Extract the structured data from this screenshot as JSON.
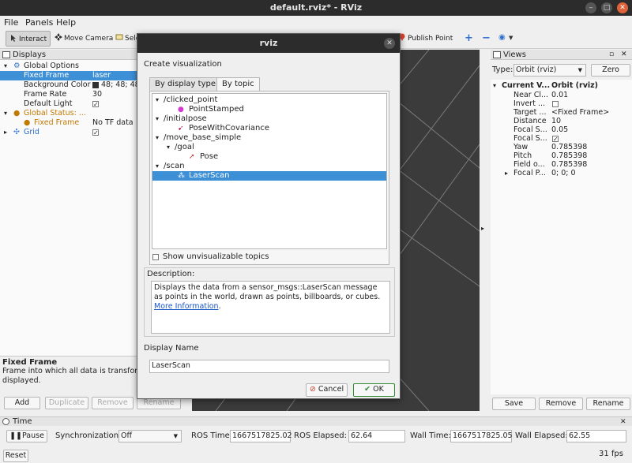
{
  "window": {
    "title": "default.rviz* - RViz"
  },
  "menu": [
    "File",
    "Panels",
    "Help"
  ],
  "toolbar": {
    "interact": "Interact",
    "move_camera": "Move Camera",
    "select": "Sele",
    "publish_point": "Publish Point"
  },
  "displays": {
    "header": "Displays",
    "rows": [
      {
        "indent": 1,
        "label": "Global Options",
        "value": ""
      },
      {
        "indent": 2,
        "label": "Fixed Frame",
        "value": "laser"
      },
      {
        "indent": 2,
        "label": "Background Color",
        "value": "48; 48; 48"
      },
      {
        "indent": 2,
        "label": "Frame Rate",
        "value": "30"
      },
      {
        "indent": 2,
        "label": "Default Light",
        "value": "✓"
      },
      {
        "indent": 1,
        "label": "Global Status: ...",
        "value": ""
      },
      {
        "indent": 2,
        "label": "Fixed Frame",
        "value": "No TF data"
      },
      {
        "indent": 1,
        "label": "Grid",
        "value": "✓"
      }
    ],
    "desc_title": "Fixed Frame",
    "desc_text": "Frame into which all data is transform being displayed.",
    "buttons": {
      "add": "Add",
      "duplicate": "Duplicate",
      "remove": "Remove",
      "rename": "Rename"
    }
  },
  "views": {
    "header": "Views",
    "type_label": "Type:",
    "type_value": "Orbit (rviz)",
    "zero": "Zero",
    "rows": [
      {
        "label": "Current V...",
        "value": "Orbit (rviz)"
      },
      {
        "label": "Near Cl...",
        "value": "0.01"
      },
      {
        "label": "Invert ...",
        "value": ""
      },
      {
        "label": "Target ...",
        "value": "<Fixed Frame>"
      },
      {
        "label": "Distance",
        "value": "10"
      },
      {
        "label": "Focal S...",
        "value": "0.05"
      },
      {
        "label": "Focal S...",
        "value": "✓"
      },
      {
        "label": "Yaw",
        "value": "0.785398"
      },
      {
        "label": "Pitch",
        "value": "0.785398"
      },
      {
        "label": "Field o...",
        "value": "0.785398"
      },
      {
        "label": "Focal P...",
        "value": "0; 0; 0"
      }
    ],
    "buttons": {
      "save": "Save",
      "remove": "Remove",
      "rename": "Rename"
    }
  },
  "time": {
    "header": "Time",
    "pause": "Pause",
    "sync_label": "Synchronization:",
    "sync_value": "Off",
    "ros_time_label": "ROS Time:",
    "ros_time": "1667517825.02",
    "ros_elapsed_label": "ROS Elapsed:",
    "ros_elapsed": "62.64",
    "wall_time_label": "Wall Time:",
    "wall_time": "1667517825.05",
    "wall_elapsed_label": "Wall Elapsed:",
    "wall_elapsed": "62.55",
    "reset": "Reset",
    "fps": "31 fps"
  },
  "dialog": {
    "title": "rviz",
    "heading": "Create visualization",
    "tabs": [
      "By display type",
      "By topic"
    ],
    "topics": [
      {
        "indent": 0,
        "label": "/clicked_point",
        "kind": "topic"
      },
      {
        "indent": 1,
        "label": "PointStamped",
        "kind": "point"
      },
      {
        "indent": 0,
        "label": "/initialpose",
        "kind": "topic"
      },
      {
        "indent": 1,
        "label": "PoseWithCovariance",
        "kind": "posecov"
      },
      {
        "indent": 0,
        "label": "/move_base_simple",
        "kind": "topic"
      },
      {
        "indent": 1,
        "label": "/goal",
        "kind": "topic"
      },
      {
        "indent": 2,
        "label": "Pose",
        "kind": "pose"
      },
      {
        "indent": 0,
        "label": "/scan",
        "kind": "topic"
      },
      {
        "indent": 1,
        "label": "LaserScan",
        "kind": "laser"
      }
    ],
    "show_unvisualizable": "Show unvisualizable topics",
    "description_label": "Description:",
    "description": "Displays the data from a sensor_msgs::LaserScan message as points in the world, drawn as points, billboards, or cubes.",
    "more_info": "More Information",
    "display_name_label": "Display Name",
    "display_name": "LaserScan",
    "cancel": "Cancel",
    "ok": "OK"
  }
}
